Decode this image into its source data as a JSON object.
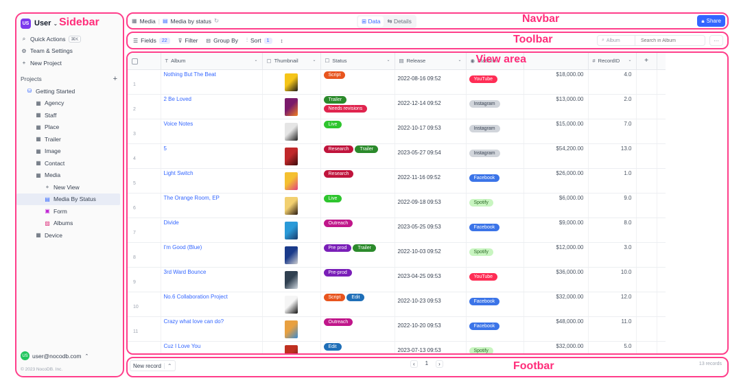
{
  "annotations": {
    "sidebar": "Sidebar",
    "navbar": "Navbar",
    "toolbar": "Toolbar",
    "view": "View area",
    "footbar": "Footbar"
  },
  "sidebar": {
    "logo": "US",
    "title": "User",
    "quick_actions": "Quick Actions",
    "quick_kbd": "⌘K",
    "team_settings": "Team & Settings",
    "new_project": "New Project",
    "projects_label": "Projects",
    "tree": [
      {
        "label": "Getting Started",
        "icon": "database-icon",
        "level": 0
      },
      {
        "label": "Agency",
        "icon": "table-icon",
        "level": 1
      },
      {
        "label": "Staff",
        "icon": "table-icon",
        "level": 1
      },
      {
        "label": "Place",
        "icon": "table-icon",
        "level": 1
      },
      {
        "label": "Trailer",
        "icon": "table-icon",
        "level": 1
      },
      {
        "label": "Image",
        "icon": "table-icon",
        "level": 1
      },
      {
        "label": "Contact",
        "icon": "table-icon",
        "level": 1
      },
      {
        "label": "Media",
        "icon": "table-icon",
        "level": 1
      },
      {
        "label": "New View",
        "icon": "plus-icon",
        "level": 2
      },
      {
        "label": "Media By Status",
        "icon": "kanban-icon",
        "level": 2,
        "active": true
      },
      {
        "label": "Form",
        "icon": "form-icon",
        "level": 2
      },
      {
        "label": "Albums",
        "icon": "gallery-icon",
        "level": 2
      },
      {
        "label": "Device",
        "icon": "table-icon",
        "level": 1
      }
    ],
    "user_email": "user@nocodb.com",
    "avatar": "US",
    "copyright": "© 2023 NocoDB. Inc."
  },
  "navbar": {
    "crumb_table": "Media",
    "crumb_view": "Media by status",
    "tab_data": "Data",
    "tab_details": "Details",
    "share": "Share"
  },
  "toolbar": {
    "fields": "Fields",
    "fields_count": "22",
    "filter": "Filter",
    "group_by": "Group By",
    "sort": "Sort",
    "sort_count": "1",
    "search_field": "Album",
    "search_placeholder": "Search in Album"
  },
  "grid": {
    "columns": [
      "Album",
      "Thumbnail",
      "Status",
      "Release",
      "Platform",
      "",
      "RecordID"
    ],
    "rows": [
      {
        "n": "1",
        "album": "Nothing But The Beat",
        "thumb": [
          "#f5c518",
          "#1a1a1a"
        ],
        "status": [
          {
            "t": "Script",
            "c": "#e8551e"
          }
        ],
        "release": "2022-08-16 09:52",
        "platform": {
          "t": "YouTube",
          "bg": "#ff2d55",
          "fg": "#ffffff"
        },
        "amount": "$18,000.00",
        "rid": "4.0"
      },
      {
        "n": "2",
        "album": "2 Be Loved",
        "thumb": [
          "#7a1a6a",
          "#f08020"
        ],
        "status": [
          {
            "t": "Trailer",
            "c": "#2b8a2b"
          },
          {
            "t": "Needs revisions",
            "c": "#e0244e"
          }
        ],
        "release": "2022-12-14 09:52",
        "platform": {
          "t": "Instagram",
          "bg": "#d1d5db",
          "fg": "#374151"
        },
        "amount": "$13,000.00",
        "rid": "2.0"
      },
      {
        "n": "3",
        "album": "Voice Notes",
        "thumb": [
          "#e5e5e5",
          "#222222"
        ],
        "status": [
          {
            "t": "Live",
            "c": "#2ec52e"
          }
        ],
        "release": "2022-10-17 09:53",
        "platform": {
          "t": "Instagram",
          "bg": "#d1d5db",
          "fg": "#374151"
        },
        "amount": "$15,000.00",
        "rid": "7.0"
      },
      {
        "n": "4",
        "album": "5",
        "thumb": [
          "#c0282a",
          "#3a0a0a"
        ],
        "status": [
          {
            "t": "Research",
            "c": "#c0143c"
          },
          {
            "t": "Trailer",
            "c": "#2b8a2b"
          }
        ],
        "release": "2023-05-27 09:54",
        "platform": {
          "t": "Instagram",
          "bg": "#d1d5db",
          "fg": "#374151"
        },
        "amount": "$54,200.00",
        "rid": "13.0"
      },
      {
        "n": "5",
        "album": "Light Switch",
        "thumb": [
          "#f4c030",
          "#e04080"
        ],
        "status": [
          {
            "t": "Research",
            "c": "#c0143c"
          }
        ],
        "release": "2022-11-16 09:52",
        "platform": {
          "t": "Facebook",
          "bg": "#3b74e8",
          "fg": "#ffffff"
        },
        "amount": "$26,000.00",
        "rid": "1.0"
      },
      {
        "n": "6",
        "album": "The Orange Room, EP",
        "thumb": [
          "#f2d070",
          "#2a1a10"
        ],
        "status": [
          {
            "t": "Live",
            "c": "#2ec52e"
          }
        ],
        "release": "2022-09-18 09:53",
        "platform": {
          "t": "Spotify",
          "bg": "#c8f5c0",
          "fg": "#2f6b2a"
        },
        "amount": "$6,000.00",
        "rid": "9.0"
      },
      {
        "n": "7",
        "album": "Divide",
        "thumb": [
          "#2a9ad8",
          "#1a3a6a"
        ],
        "status": [
          {
            "t": "Outreach",
            "c": "#c0168a"
          }
        ],
        "release": "2023-05-25 09:53",
        "platform": {
          "t": "Facebook",
          "bg": "#3b74e8",
          "fg": "#ffffff"
        },
        "amount": "$9,000.00",
        "rid": "8.0"
      },
      {
        "n": "8",
        "album": "I'm Good (Blue)",
        "thumb": [
          "#1a3a8a",
          "#d0d0d0"
        ],
        "status": [
          {
            "t": "Pre prod",
            "c": "#7a1fb8"
          },
          {
            "t": "Trailer",
            "c": "#2b8a2b"
          }
        ],
        "release": "2022-10-03 09:52",
        "platform": {
          "t": "Spotify",
          "bg": "#c8f5c0",
          "fg": "#2f6b2a"
        },
        "amount": "$12,000.00",
        "rid": "3.0"
      },
      {
        "n": "9",
        "album": "3rd Ward Bounce",
        "thumb": [
          "#304050",
          "#d0d8e0"
        ],
        "status": [
          {
            "t": "Pre-prod",
            "c": "#7a1fb8"
          }
        ],
        "release": "2023-04-25 09:53",
        "platform": {
          "t": "YouTube",
          "bg": "#ff2d55",
          "fg": "#ffffff"
        },
        "amount": "$36,000.00",
        "rid": "10.0"
      },
      {
        "n": "10",
        "album": "No.6 Collaboration Project",
        "thumb": [
          "#f5f5f5",
          "#111111"
        ],
        "status": [
          {
            "t": "Script",
            "c": "#e8551e"
          },
          {
            "t": "Edit",
            "c": "#1f6fb8"
          }
        ],
        "release": "2022-10-23 09:53",
        "platform": {
          "t": "Facebook",
          "bg": "#3b74e8",
          "fg": "#ffffff"
        },
        "amount": "$32,000.00",
        "rid": "12.0"
      },
      {
        "n": "11",
        "album": "Crazy what love can do?",
        "thumb": [
          "#e8a040",
          "#3a8ad0"
        ],
        "status": [
          {
            "t": "Outreach",
            "c": "#c0168a"
          }
        ],
        "release": "2022-10-20 09:53",
        "platform": {
          "t": "Facebook",
          "bg": "#3b74e8",
          "fg": "#ffffff"
        },
        "amount": "$48,000.00",
        "rid": "11.0"
      },
      {
        "n": "12",
        "album": "Cuz I Love You",
        "thumb": [
          "#c03020",
          "#5a1010"
        ],
        "status": [
          {
            "t": "Edit",
            "c": "#1f6fb8"
          }
        ],
        "release": "2023-07-13 09:53",
        "platform": {
          "t": "Spotify",
          "bg": "#c8f5c0",
          "fg": "#2f6b2a"
        },
        "amount": "$32,000.00",
        "rid": "5.0"
      }
    ]
  },
  "footbar": {
    "new_record": "New record",
    "page": "1",
    "records": "13 records"
  },
  "colors": {
    "accent": "#3366ff",
    "annotation": "#ff2d7a",
    "brand": "#7c3aed"
  }
}
